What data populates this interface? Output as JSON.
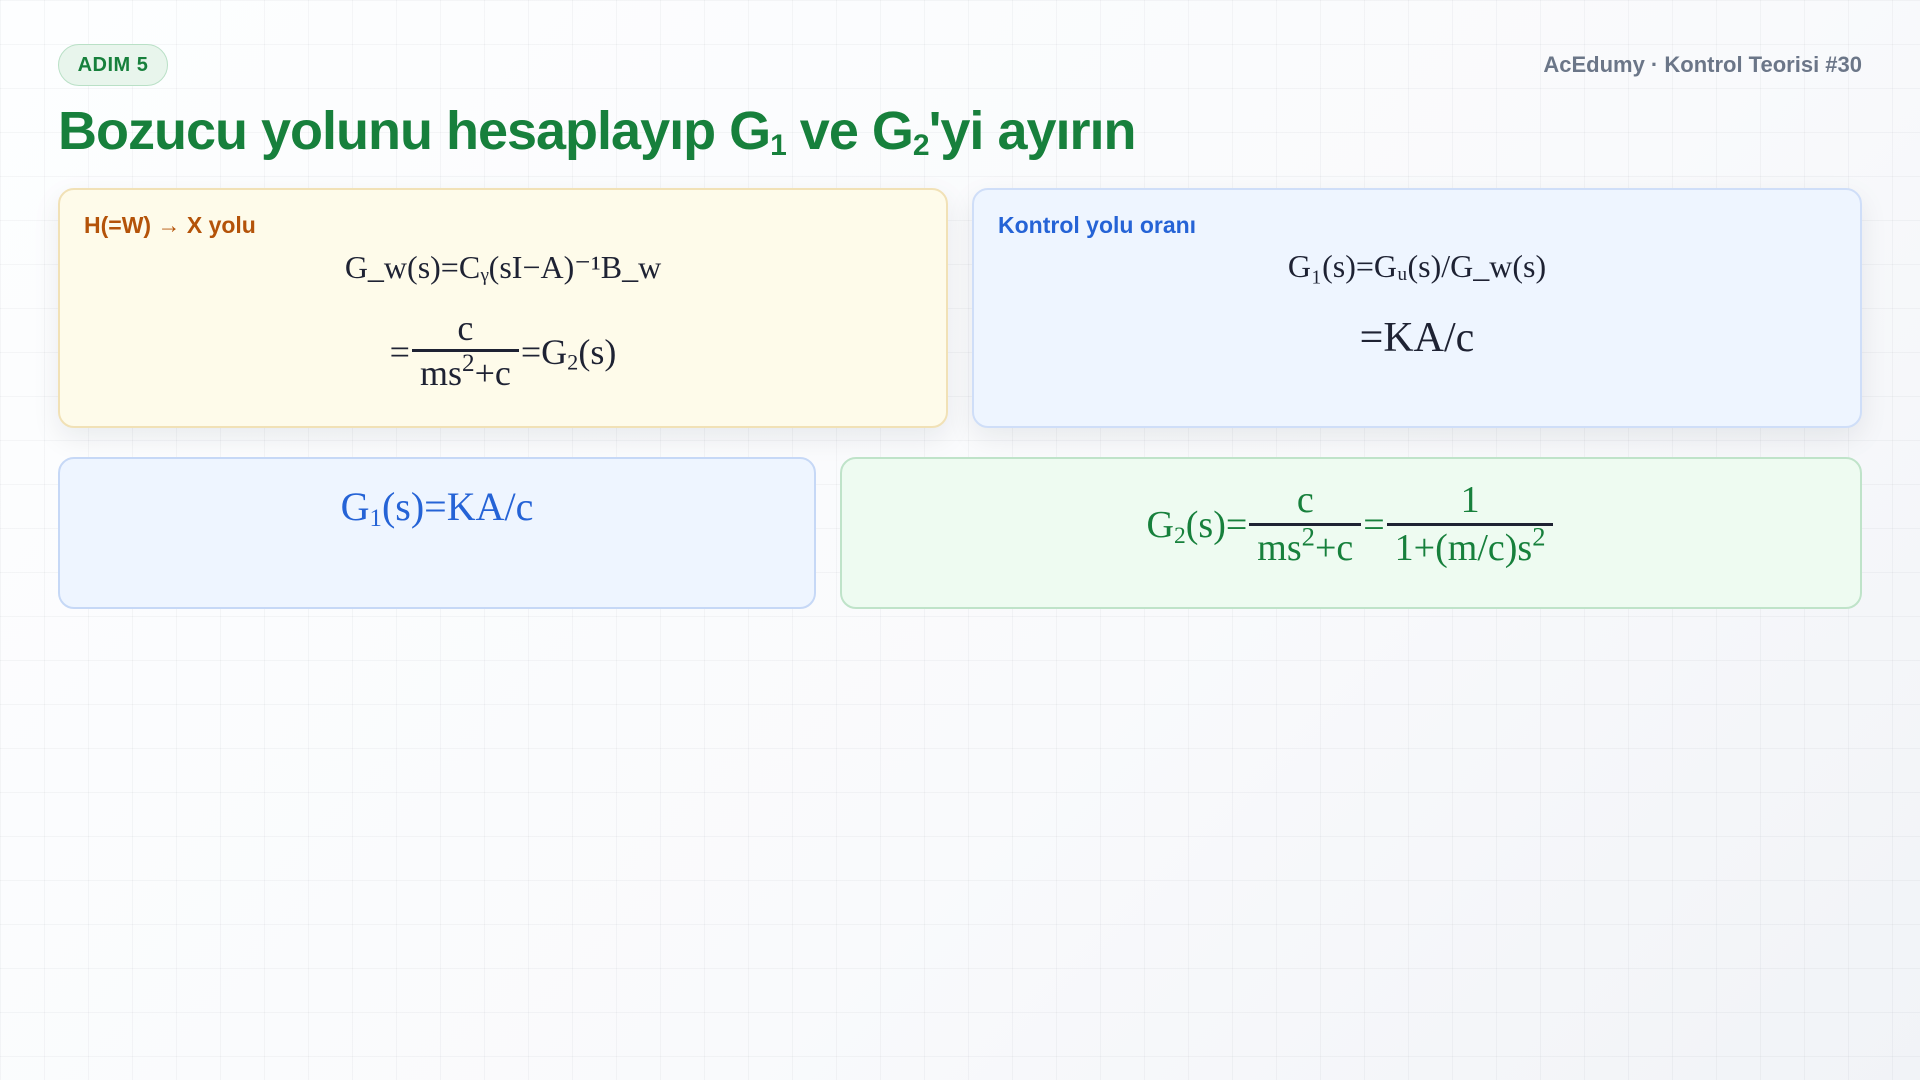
{
  "header": {
    "step_badge": "ADIM 5",
    "brand": "AcEdumy · Kontrol Teorisi #30",
    "title_pre": "Bozucu yolunu hesaplayıp G",
    "title_sub1": "1",
    "title_mid": " ve G",
    "title_sub2": "2",
    "title_post": "'yi ayırın"
  },
  "disturbance_card": {
    "label": "H(=W) → X yolu",
    "formula_line1": "G_w(s)=Cᵧ(sI−A)⁻¹B_w",
    "eq_prefix": "=",
    "frac_num": "c",
    "frac_den_base": "ms",
    "frac_den_exp": "2",
    "frac_den_tail": "+c",
    "eq_suffix_base": "=G",
    "eq_suffix_sub": "2",
    "eq_suffix_tail": "(s)"
  },
  "control_card": {
    "label": "Kontrol yolu oranı",
    "formula_line1": "G₁(s)=Gᵤ(s)/G_w(s)",
    "formula_line2": "=KA/c"
  },
  "result_g1": {
    "base": "G",
    "sub": "1",
    "tail": "(s)=KA/c"
  },
  "result_g2": {
    "base": "G",
    "sub": "2",
    "mid": "(s)=",
    "frac1_num": "c",
    "frac1_den_base": "ms",
    "frac1_den_exp": "2",
    "frac1_den_tail": "+c",
    "eq": "=",
    "frac2_num": "1",
    "frac2_den_base": "1+(m/c)s",
    "frac2_den_exp": "2"
  },
  "colors": {
    "accent_green": "#17803c",
    "accent_blue": "#2563d6",
    "accent_orange": "#b45309"
  }
}
